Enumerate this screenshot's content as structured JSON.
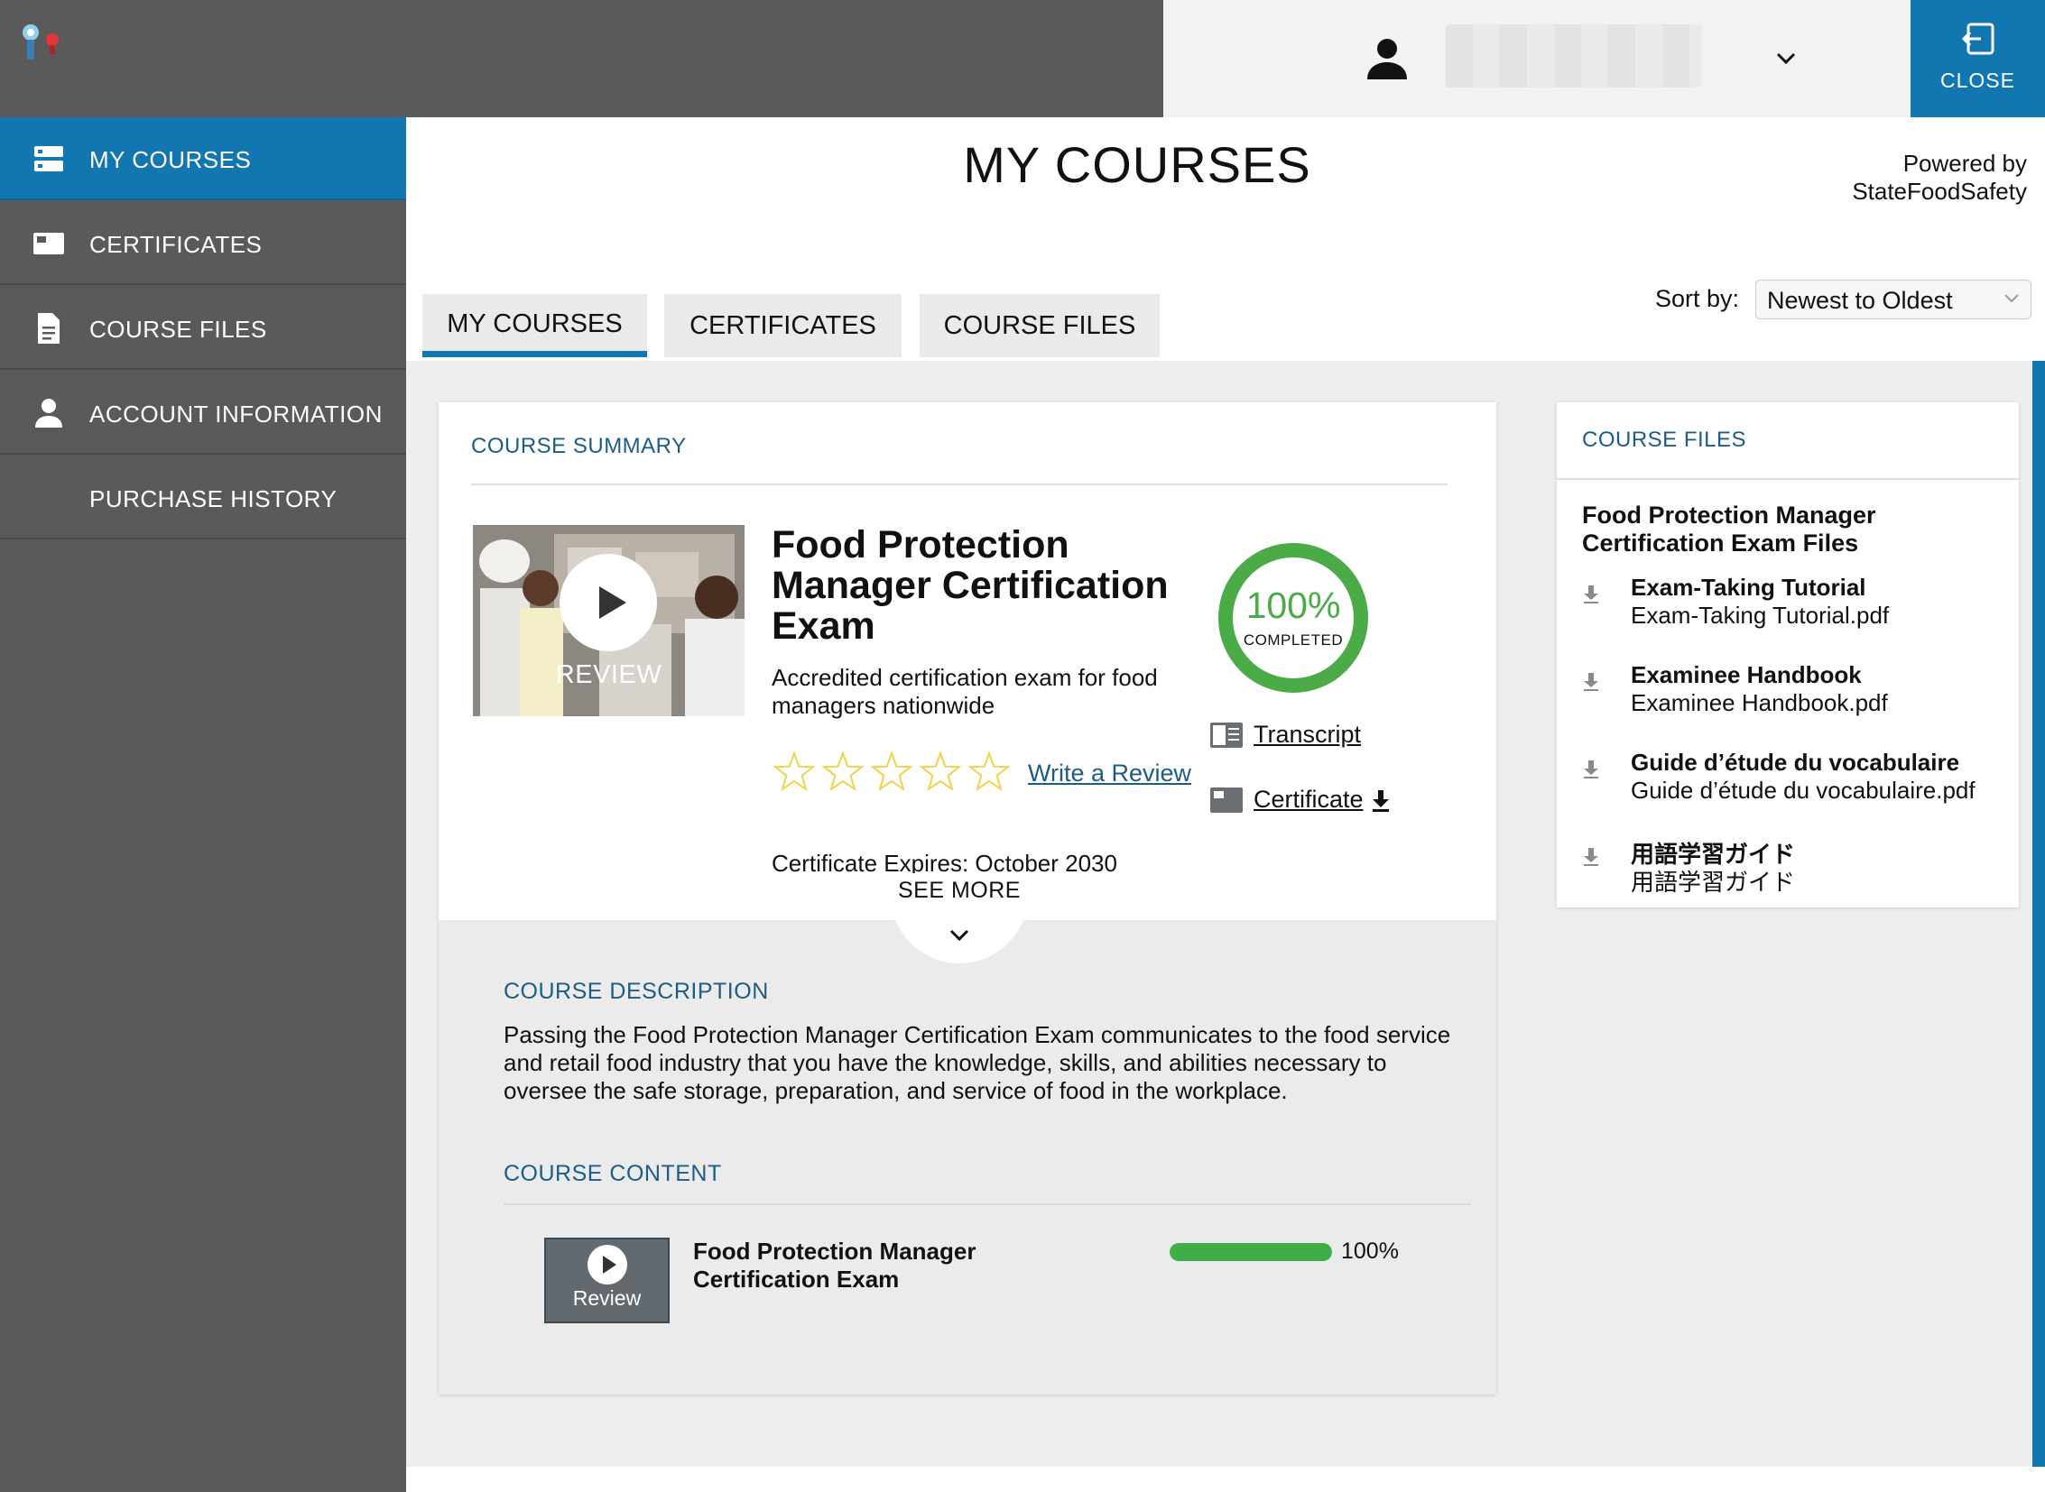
{
  "header": {
    "user_name_redacted": "",
    "close_label": "CLOSE"
  },
  "sidebar": {
    "items": [
      {
        "label": "MY COURSES",
        "icon": "courses-icon",
        "active": true
      },
      {
        "label": "CERTIFICATES",
        "icon": "certificate-icon",
        "active": false
      },
      {
        "label": "COURSE FILES",
        "icon": "file-icon",
        "active": false
      },
      {
        "label": "ACCOUNT INFORMATION",
        "icon": "person-icon",
        "active": false
      },
      {
        "label": "PURCHASE HISTORY",
        "icon": "",
        "active": false
      }
    ]
  },
  "main": {
    "page_title": "MY COURSES",
    "powered_by_line1": "Powered by",
    "powered_by_line2": "StateFoodSafety",
    "tabs": [
      {
        "label": "MY COURSES",
        "active": true
      },
      {
        "label": "CERTIFICATES",
        "active": false
      },
      {
        "label": "COURSE FILES",
        "active": false
      }
    ],
    "sort_label": "Sort by:",
    "sort_value": "Newest to Oldest"
  },
  "course": {
    "summary_title": "COURSE SUMMARY",
    "thumb_label": "REVIEW",
    "title": "Food Protection Manager Certification Exam",
    "subtitle": "Accredited certification exam for food managers nationwide",
    "rating": 0,
    "rating_max": 5,
    "write_review": "Write a Review",
    "progress_pct": 100,
    "progress_text": "100%",
    "progress_label": "COMPLETED",
    "transcript_label": "Transcript",
    "certificate_label": "Certificate",
    "expires": "Certificate Expires: October 2030",
    "see_more": "SEE MORE",
    "description_title": "COURSE DESCRIPTION",
    "description": "Passing the Food Protection Manager Certification Exam communicates to the food service and retail food industry that you have the knowledge, skills, and abilities necessary to oversee the safe storage, preparation, and service of food in the workplace.",
    "content_title": "COURSE CONTENT",
    "content_items": [
      {
        "thumb_label": "Review",
        "title": "Food Protection Manager Certification Exam",
        "progress": 100,
        "progress_text": "100%"
      }
    ]
  },
  "files_panel": {
    "title": "COURSE FILES",
    "group_title": "Food Protection Manager Certification Exam Files",
    "files": [
      {
        "name": "Exam-Taking Tutorial",
        "file": "Exam-Taking Tutorial.pdf"
      },
      {
        "name": "Examinee Handbook",
        "file": "Examinee Handbook.pdf"
      },
      {
        "name": "Guide d’étude du vocabulaire",
        "file": "Guide d’étude du vocabulaire.pdf"
      },
      {
        "name": "用語学習ガイド",
        "file": "用語学習ガイド"
      }
    ]
  },
  "colors": {
    "accent": "#1276b0",
    "sidebar": "#5a5a5a",
    "success": "#4aab47",
    "heading_blue": "#1c5d86",
    "star": "#f2d24b"
  }
}
